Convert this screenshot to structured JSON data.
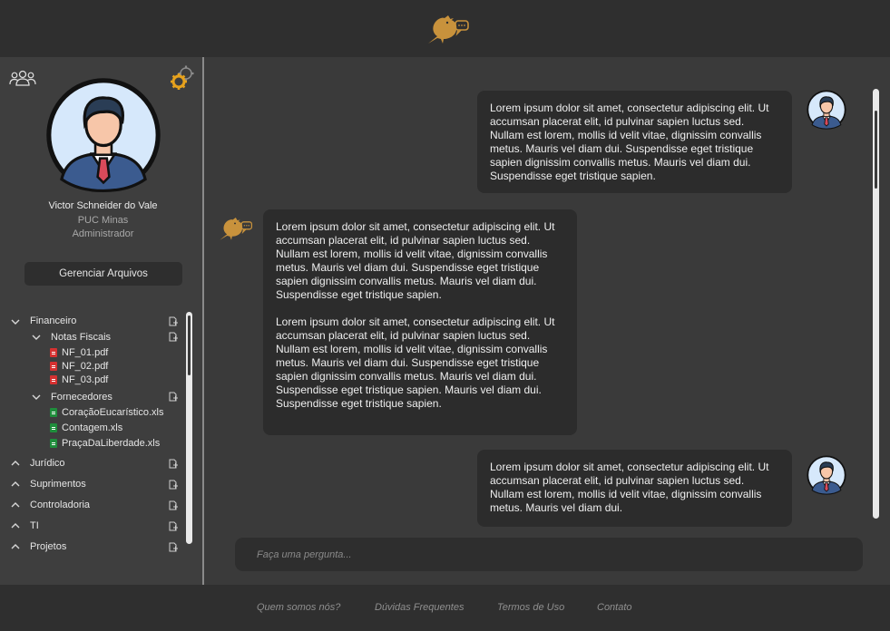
{
  "header": {
    "logo_icon": "bird-chat-logo-icon"
  },
  "profile": {
    "name": "Victor Schneider do Vale",
    "organization": "PUC Minas",
    "role": "Administrador",
    "manage_files_label": "Gerenciar Arquivos"
  },
  "tree": {
    "folders": [
      {
        "label": "Financeiro",
        "expanded": true,
        "children": [
          {
            "label": "Notas Fiscais",
            "expanded": true,
            "files": [
              "NF_01.pdf",
              "NF_02.pdf",
              "NF_03.pdf"
            ]
          },
          {
            "label": "Fornecedores",
            "expanded": true,
            "files": [
              "CoraçãoEucarístico.xls",
              "Contagem.xls",
              "PraçaDaLiberdade.xls"
            ]
          }
        ]
      },
      {
        "label": "Jurídico",
        "expanded": false
      },
      {
        "label": "Suprimentos",
        "expanded": false
      },
      {
        "label": "Controladoria",
        "expanded": false
      },
      {
        "label": "TI",
        "expanded": false
      },
      {
        "label": "Projetos",
        "expanded": false
      }
    ]
  },
  "chat": {
    "messages": [
      {
        "sender": "user",
        "paragraphs": [
          "Lorem ipsum dolor sit amet, consectetur adipiscing elit. Ut accumsan placerat elit, id pulvinar sapien luctus sed. Nullam est lorem, mollis id velit vitae, dignissim convallis metus. Mauris vel diam dui. Suspendisse eget tristique sapien dignissim convallis metus. Mauris vel diam dui. Suspendisse eget tristique sapien."
        ]
      },
      {
        "sender": "bot",
        "paragraphs": [
          "Lorem ipsum dolor sit amet, consectetur adipiscing elit. Ut accumsan placerat elit, id pulvinar sapien luctus sed. Nullam est lorem, mollis id velit vitae, dignissim convallis metus. Mauris vel diam dui. Suspendisse eget tristique sapien dignissim convallis metus. Mauris vel diam dui. Suspendisse eget tristique sapien.",
          "Lorem ipsum dolor sit amet, consectetur adipiscing elit. Ut accumsan placerat elit, id pulvinar sapien luctus sed. Nullam est lorem, mollis id velit vitae, dignissim convallis metus. Mauris vel diam dui. Suspendisse eget tristique sapien dignissim convallis metus. Mauris vel diam dui. Suspendisse eget tristique sapien. Mauris vel diam dui. Suspendisse eget tristique sapien."
        ]
      },
      {
        "sender": "user",
        "paragraphs": [
          "Lorem ipsum dolor sit amet, consectetur adipiscing elit. Ut accumsan placerat elit, id pulvinar sapien luctus sed. Nullam est lorem, mollis id velit vitae, dignissim convallis metus. Mauris vel diam dui."
        ]
      }
    ],
    "input_placeholder": "Faça uma pergunta..."
  },
  "footer": {
    "links": [
      "Quem somos nós?",
      "Dúvidas Frequentes",
      "Termos de Uso",
      "Contato"
    ]
  },
  "colors": {
    "accent": "#c8923c",
    "background": "#3a3a3a",
    "header": "#2f2f2f",
    "bubble": "#2c2c2c"
  }
}
